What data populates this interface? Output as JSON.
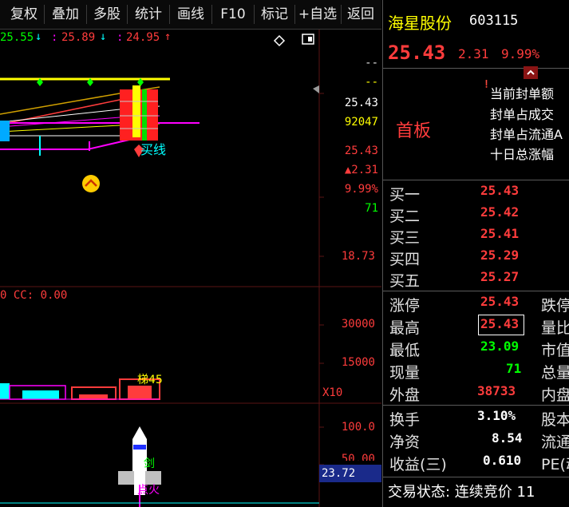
{
  "toolbar": {
    "buttons": [
      "复权",
      "叠加",
      "多股",
      "统计",
      "画线",
      "F10",
      "标记",
      "+自选",
      "返回"
    ]
  },
  "chart": {
    "ma_values": [
      "25.55",
      "25.89",
      "24.95"
    ],
    "arrows": [
      "↓",
      "↓",
      "↑"
    ],
    "buy_signal": "买线",
    "axis_top": [
      "--",
      "--",
      "25.43",
      "92047",
      "25.43",
      "▲2.31",
      "9.99%",
      "71",
      "18.73"
    ],
    "volume_header": "0 CC: 0.00",
    "vol_axis": [
      "30000",
      "15000",
      "X10"
    ],
    "ladder_label": "梯45",
    "sword_label": "剑",
    "ignite_label": "点火",
    "ind_axis": [
      "100.0",
      "50.00",
      "23.72"
    ],
    "colors": {
      "up": "#ff3c3c",
      "down": "#00ff00",
      "yellow": "#ffff00",
      "magenta": "#ff00ff",
      "cyan": "#00ffff",
      "panel_border": "#5a1414"
    }
  },
  "quote": {
    "name": "海星股份",
    "code": "603115",
    "price": "25.43",
    "change": "2.31",
    "pct": "9.99%",
    "board": "首板",
    "seal_labels": [
      "当前封单额",
      "封单占成交",
      "封单占流通A",
      "十日总涨幅"
    ],
    "bids": [
      {
        "label": "买一",
        "price": "25.43"
      },
      {
        "label": "买二",
        "price": "25.42"
      },
      {
        "label": "买三",
        "price": "25.41"
      },
      {
        "label": "买四",
        "price": "25.29"
      },
      {
        "label": "买五",
        "price": "25.27"
      }
    ],
    "stats": [
      {
        "label": "涨停",
        "value": "25.43",
        "side": "跌停"
      },
      {
        "label": "最高",
        "value": "25.43",
        "side": "量比"
      },
      {
        "label": "最低",
        "value": "23.09",
        "side": "市值"
      },
      {
        "label": "现量",
        "value": "71",
        "side": "总量"
      },
      {
        "label": "外盘",
        "value": "38733",
        "side": "内盘"
      }
    ],
    "fund": [
      {
        "label": "换手",
        "value": "3.10%",
        "side": "股本"
      },
      {
        "label": "净资",
        "value": "8.54",
        "side": "流通"
      },
      {
        "label": "收益(三)",
        "value": "0.610",
        "side": "PE(动"
      }
    ],
    "status": "交易状态: 连续竞价 11"
  }
}
